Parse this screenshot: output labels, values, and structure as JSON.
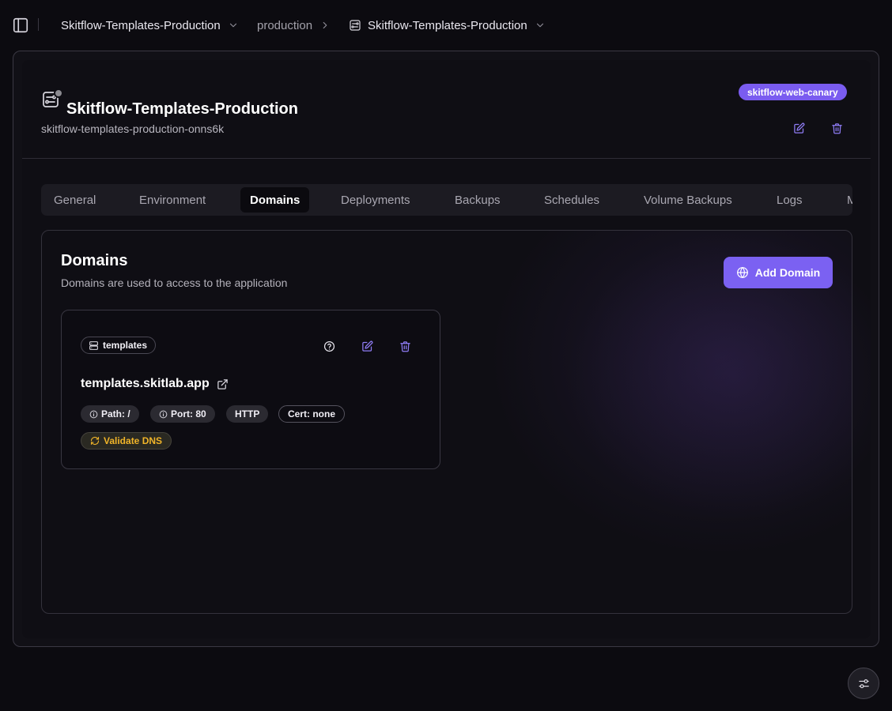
{
  "breadcrumb": {
    "project": "Skitflow-Templates-Production",
    "environment": "production",
    "application": "Skitflow-Templates-Production"
  },
  "header": {
    "title": "Skitflow-Templates-Production",
    "app_name": "skitflow-templates-production-onns6k",
    "server_badge": "skitflow-web-canary"
  },
  "tabs": [
    {
      "label": "General"
    },
    {
      "label": "Environment"
    },
    {
      "label": "Domains",
      "active": true
    },
    {
      "label": "Deployments"
    },
    {
      "label": "Backups"
    },
    {
      "label": "Schedules"
    },
    {
      "label": "Volume Backups"
    },
    {
      "label": "Logs"
    },
    {
      "label": "M"
    }
  ],
  "domains_section": {
    "title": "Domains",
    "description": "Domains are used to access to the application",
    "add_button": "Add Domain"
  },
  "domain": {
    "service": "templates",
    "host": "templates.skitlab.app",
    "path": "Path: /",
    "port": "Port: 80",
    "protocol": "HTTP",
    "cert": "Cert: none",
    "validate": "Validate DNS"
  },
  "colors": {
    "accent": "#7b61f2",
    "warning": "#f0b429",
    "background": "#0c0b10"
  }
}
